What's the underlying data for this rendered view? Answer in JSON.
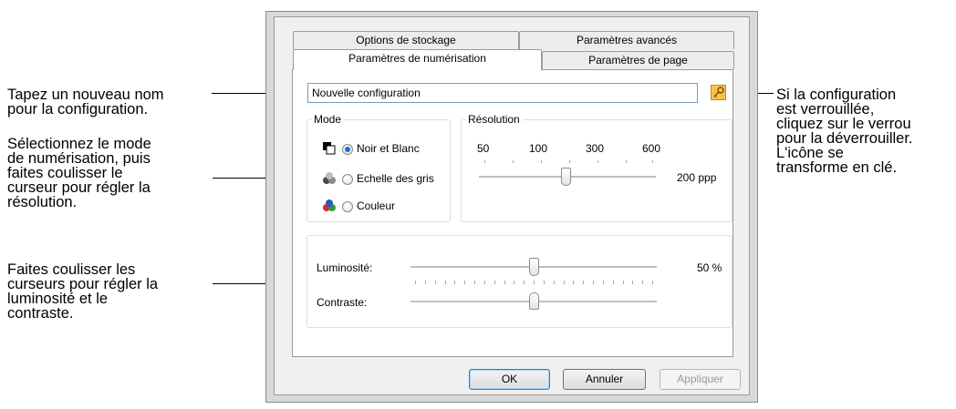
{
  "callouts": {
    "name": [
      "Tapez un nouveau nom",
      "pour la configuration."
    ],
    "mode": [
      "Sélectionnez le mode",
      "de numérisation, puis",
      "faites coulisser le",
      "curseur pour régler la",
      "résolution."
    ],
    "sliders": [
      "Faites coulisser les",
      "curseurs pour régler la",
      "luminosité et le",
      "contraste."
    ],
    "lock": [
      "Si la configuration",
      "est verrouillée,",
      "cliquez sur le verrou",
      "pour la déverrouiller.",
      "L'icône se",
      "transforme en clé."
    ]
  },
  "tabs": {
    "storage": "Options de stockage",
    "advanced": "Paramètres avancés",
    "scan": "Paramètres de numérisation",
    "page": "Paramètres de page"
  },
  "config_name": {
    "value": "Nouvelle configuration"
  },
  "lock_button": {
    "icon": "key-icon",
    "color": "#f6c24a"
  },
  "mode": {
    "label": "Mode",
    "options": [
      {
        "label": "Noir et Blanc",
        "icon": "black-white-mode-icon",
        "selected": true
      },
      {
        "label": "Echelle des gris",
        "icon": "grayscale-mode-icon",
        "selected": false
      },
      {
        "label": "Couleur",
        "icon": "color-mode-icon",
        "selected": false
      }
    ]
  },
  "resolution": {
    "label": "Résolution",
    "ticks": [
      "50",
      "100",
      "300",
      "600"
    ],
    "value_label": "200 ppp",
    "slider_fraction": 0.49
  },
  "brightness": {
    "label": "Luminosité:",
    "value_label": "50 %",
    "slider_fraction": 0.5
  },
  "contrast": {
    "label": "Contraste:",
    "slider_fraction": 0.5
  },
  "buttons": {
    "ok": "OK",
    "cancel": "Annuler",
    "apply": "Appliquer"
  }
}
